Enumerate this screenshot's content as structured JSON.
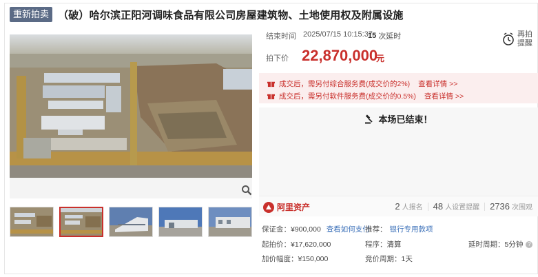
{
  "header": {
    "badge": "重新拍卖",
    "title": "（破）哈尔滨正阳河调味食品有限公司房屋建筑物、土地使用权及附属设施"
  },
  "auction": {
    "end_time_label": "结束时间",
    "end_time": "2025/07/15 10:15:37",
    "ext_count": "15",
    "ext_suffix": "次延时",
    "remind_label": "再拍提醒",
    "price_label": "拍下价",
    "price": "22,870,000",
    "price_unit": "元",
    "fees": [
      {
        "text": "成交后，需另付综合服务费(成交价的2%)",
        "link": "查看详情 >>"
      },
      {
        "text": "成交后，需另付软件服务费(成交价的0.5%)",
        "link": "查看详情 >>"
      }
    ],
    "ended_text": "本场已结束！"
  },
  "stats": {
    "brand": "阿里资产",
    "signups": "2",
    "signups_label": "人报名",
    "reminders": "48",
    "reminders_label": "人设置提醒",
    "views": "2736",
    "views_label": "次围观"
  },
  "details": {
    "deposit_label": "保证金：",
    "deposit": "¥900,000",
    "deposit_link": "查看如何支付",
    "recommend_label": "推荐：",
    "recommend_link": "银行专用款项",
    "start_price_label": "起拍价：",
    "start_price": "¥17,620,000",
    "procedure_label": "程序：",
    "procedure": "清算",
    "ext_period_label": "延时周期：",
    "ext_period": "5分钟",
    "increment_label": "加价幅度：",
    "increment": "¥150,000",
    "bid_period_label": "竞价周期：",
    "bid_period": "1天"
  },
  "colors": {
    "accent": "#c9302c",
    "badge": "#5b6b86",
    "link": "#3a6fb8"
  },
  "icons": [
    "clock-remind-icon",
    "zoom-icon",
    "gift-icon",
    "gavel-icon",
    "ali-asset-logo-icon",
    "help-icon"
  ]
}
